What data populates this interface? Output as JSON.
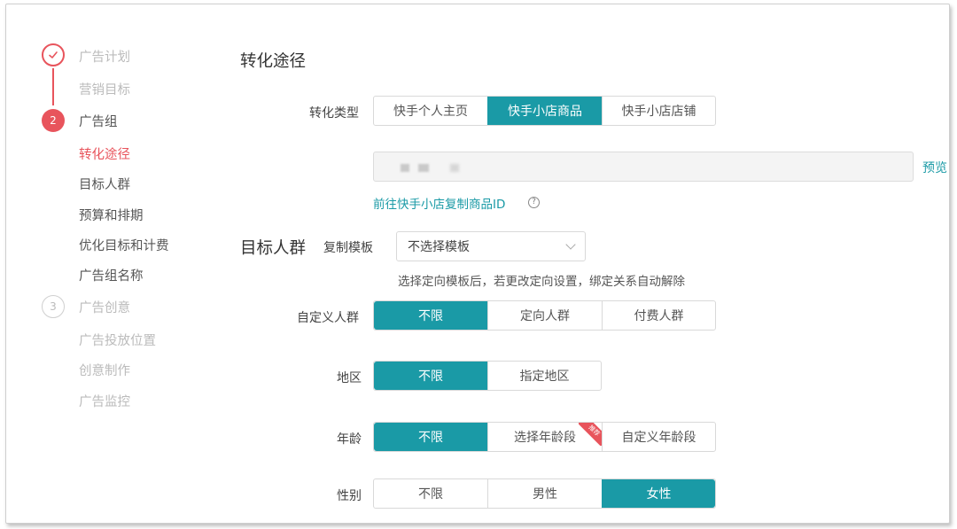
{
  "sidebar": {
    "steps": [
      {
        "number": "✓",
        "label": "广告计划",
        "status": "done"
      },
      {
        "number": "2",
        "label": "广告组",
        "status": "active"
      },
      {
        "number": "3",
        "label": "广告创意",
        "status": "todo"
      }
    ],
    "plan_sub": [
      "营销目标"
    ],
    "group_sub": [
      "转化途径",
      "目标人群",
      "预算和排期",
      "优化目标和计费",
      "广告组名称"
    ],
    "creative_sub": [
      "广告投放位置",
      "创意制作",
      "广告监控"
    ],
    "current_item": "转化途径"
  },
  "conversion": {
    "section_title": "转化途径",
    "type_label": "转化类型",
    "options": [
      "快手个人主页",
      "快手小店商品",
      "快手小店店铺"
    ],
    "selected": "快手小店商品",
    "preview_link": "预览",
    "copy_link": "前往快手小店复制商品ID"
  },
  "audience": {
    "section_title": "目标人群",
    "template_label": "复制模板",
    "template_value": "不选择模板",
    "template_hint": "选择定向模板后，若更改定向设置，绑定关系自动解除",
    "custom": {
      "label": "自定义人群",
      "options": [
        "不限",
        "定向人群",
        "付费人群"
      ],
      "selected": "不限"
    },
    "region": {
      "label": "地区",
      "options": [
        "不限",
        "指定地区"
      ],
      "selected": "不限"
    },
    "age": {
      "label": "年龄",
      "options": [
        "不限",
        "选择年龄段",
        "自定义年龄段"
      ],
      "selected": "不限",
      "badge": "推荐"
    },
    "gender": {
      "label": "性别",
      "options": [
        "不限",
        "男性",
        "女性"
      ],
      "selected": "女性"
    }
  },
  "colors": {
    "accent": "#1a9aa6",
    "step_red": "#e8545c"
  }
}
